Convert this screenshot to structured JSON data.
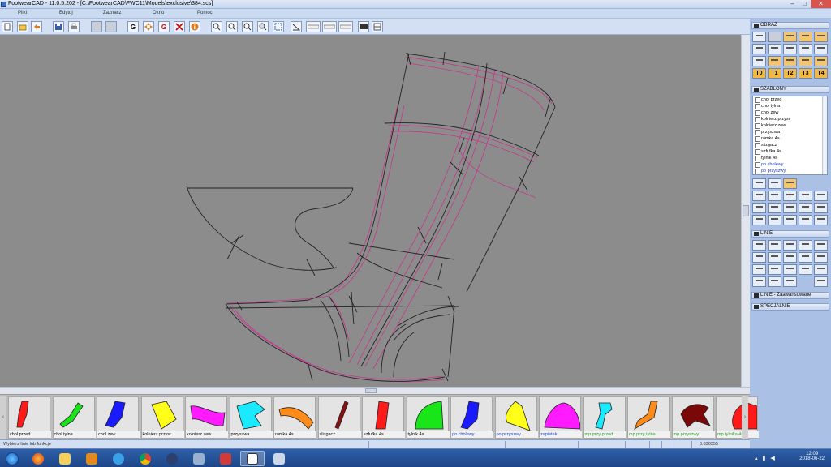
{
  "window": {
    "title": "FootwearCAD - 11.0.5.202 - [C:\\FootwearCAD\\FWC11\\Models\\exclusive\\384.scs]",
    "controls": {
      "minimize": "–",
      "maximize": "□",
      "close": "✕"
    }
  },
  "menu": [
    "Pliki",
    "Edytuj",
    "Zaznacz",
    "Okno",
    "Pomoc"
  ],
  "toolbar": {
    "icons": [
      "new-icon",
      "open-icon",
      "undo-icon",
      "save-icon",
      "print-icon",
      "blank-icon",
      "blank-icon",
      "g-icon",
      "move-icon",
      "g-delete-icon",
      "delete-icon",
      "info-icon",
      "zoom-out-icon",
      "zoom-in-icon",
      "zoom-plus-icon",
      "zoom-window-icon",
      "zoom-fit-icon",
      "measure-angle-icon",
      "ruler-icon",
      "ruler2-icon",
      "ruler3-icon",
      "grid-icon",
      "grid2-icon"
    ],
    "g_label": "G",
    "info_label": "i"
  },
  "right_panel": {
    "obraz_title": "OBRAZ",
    "t_buttons": [
      "T0",
      "T1",
      "T2",
      "T3",
      "T4"
    ],
    "szablony_title": "SZABLONY",
    "szablony_items": [
      {
        "label": "chol przed",
        "color": "#000000"
      },
      {
        "label": "chol tylna",
        "color": "#000000"
      },
      {
        "label": "chol zew",
        "color": "#000000"
      },
      {
        "label": "kolnierz przysr",
        "color": "#000000"
      },
      {
        "label": "kolnierz zew",
        "color": "#000000"
      },
      {
        "label": "przyszwa",
        "color": "#000000"
      },
      {
        "label": "ramka 4s",
        "color": "#000000"
      },
      {
        "label": "slizgacz",
        "color": "#000000"
      },
      {
        "label": "szfufka 4s",
        "color": "#000000"
      },
      {
        "label": "tylnik 4s",
        "color": "#000000"
      },
      {
        "label": "po cholewy",
        "color": "#1a3fbf"
      },
      {
        "label": "po przyszwy",
        "color": "#1a3fbf"
      }
    ],
    "linie_title": "LINIE",
    "linie_zaaw_title": "LINIE - Zaawansowane",
    "specjalne_title": "SPECJALNIE"
  },
  "pieces": [
    {
      "label": "chol przed",
      "color": "#ff1a1a",
      "label_color": "black"
    },
    {
      "label": "chol tylna",
      "color": "#19e619",
      "label_color": "black"
    },
    {
      "label": "chol zew",
      "color": "#1a1aff",
      "label_color": "black"
    },
    {
      "label": "kolnierz przysr",
      "color": "#ffff1a",
      "label_color": "black"
    },
    {
      "label": "kolnierz zew",
      "color": "#ff1aff",
      "label_color": "black"
    },
    {
      "label": "przyszwa",
      "color": "#1aeaff",
      "label_color": "black"
    },
    {
      "label": "ramka 4s",
      "color": "#ff8c1a",
      "label_color": "black"
    },
    {
      "label": "slizgacz",
      "color": "#8b1010",
      "label_color": "black"
    },
    {
      "label": "szfufka 4s",
      "color": "#ff1a1a",
      "label_color": "black"
    },
    {
      "label": "tylnik 4s",
      "color": "#19e619",
      "label_color": "black"
    },
    {
      "label": "po cholewy",
      "color": "#1a1aff",
      "label_color": "blue"
    },
    {
      "label": "po przyszwy",
      "color": "#ffff1a",
      "label_color": "blue"
    },
    {
      "label": "zapietek",
      "color": "#ff1aff",
      "label_color": "blue"
    },
    {
      "label": "mp przy przed",
      "color": "#1aeaff",
      "label_color": "green"
    },
    {
      "label": "mp przy tylna",
      "color": "#ff8c1a",
      "label_color": "green"
    },
    {
      "label": "mp przyszwy",
      "color": "#7a0808",
      "label_color": "green"
    },
    {
      "label": "mp tylnika 4s",
      "color": "#ff1a1a",
      "label_color": "green"
    }
  ],
  "status": {
    "message": "Wybierz linie lub funkcje",
    "value": "0.830355"
  },
  "taskbar": {
    "time": "12:09",
    "date": "2018-06-22"
  }
}
